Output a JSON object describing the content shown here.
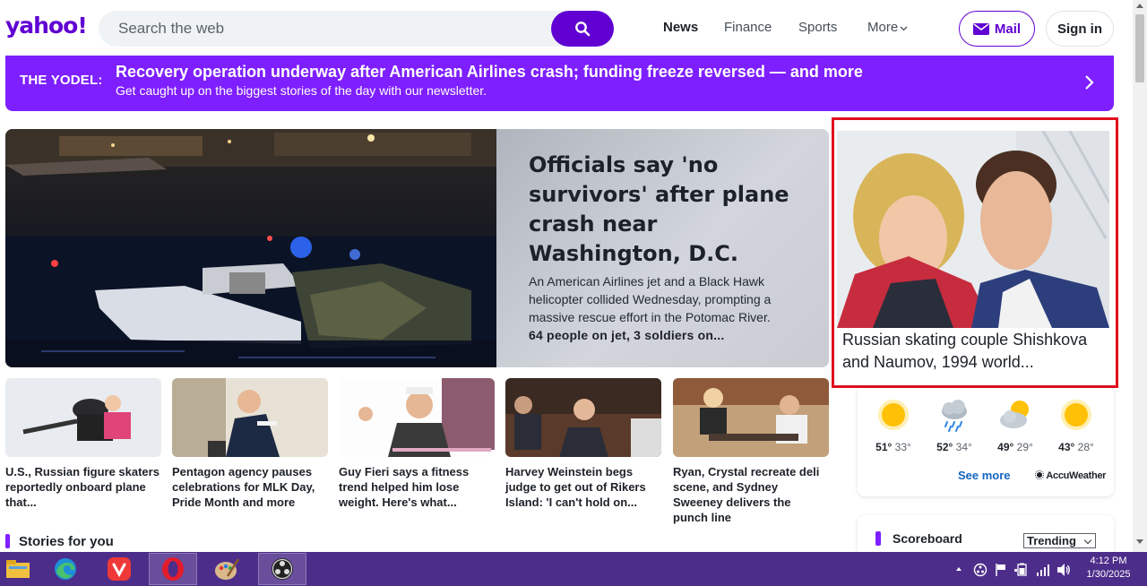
{
  "header": {
    "logo": "yahoo!",
    "search_placeholder": "Search the web",
    "nav": [
      "News",
      "Finance",
      "Sports",
      "More"
    ],
    "mail_label": "Mail",
    "signin_label": "Sign in"
  },
  "yodel": {
    "tag": "THE YODEL:",
    "title": "Recovery operation underway after American Airlines crash; funding freeze reversed — and more",
    "subtitle": "Get caught up on the biggest stories of the day with our newsletter."
  },
  "hero": {
    "title": "Officials say 'no survivors' after plane crash near Washington, D.C.",
    "description": "An American Airlines jet and a Black Hawk helicopter collided Wednesday, prompting a massive rescue effort in the Potomac River.",
    "more": "64 people on jet, 3 soldiers on..."
  },
  "cards": [
    {
      "text": "U.S., Russian figure skaters reportedly onboard plane that..."
    },
    {
      "text": "Pentagon agency pauses celebrations for MLK Day, Pride Month and more"
    },
    {
      "text": "Guy Fieri says a fitness trend helped him lose weight. Here's what..."
    },
    {
      "text": "Harvey Weinstein begs judge to get out of Rikers Island: 'I can't hold on..."
    },
    {
      "text": "Ryan, Crystal recreate deli scene, and Sydney Sweeney delivers the punch line"
    }
  ],
  "stories_label": "Stories for you",
  "featured": {
    "caption": "Russian skating couple Shishkova and Naumov, 1994 world..."
  },
  "weather": {
    "days": [
      {
        "icon": "sun-icon",
        "high": "51°",
        "low": "33°"
      },
      {
        "icon": "rain-cloud-icon",
        "high": "52°",
        "low": "34°"
      },
      {
        "icon": "partly-cloudy-icon",
        "high": "49°",
        "low": "29°"
      },
      {
        "icon": "sun-icon",
        "high": "43°",
        "low": "28°"
      }
    ],
    "see_more": "See more",
    "provider": "AccuWeather"
  },
  "scoreboard": {
    "title": "Scoreboard",
    "filter": "Trending"
  },
  "taskbar": {
    "time": "4:12 PM",
    "date": "1/30/2025"
  },
  "colors": {
    "brand": "#6001d2",
    "yodel": "#7e1fff",
    "highlight": "#e0101e",
    "taskbar": "#4d2d8a"
  }
}
